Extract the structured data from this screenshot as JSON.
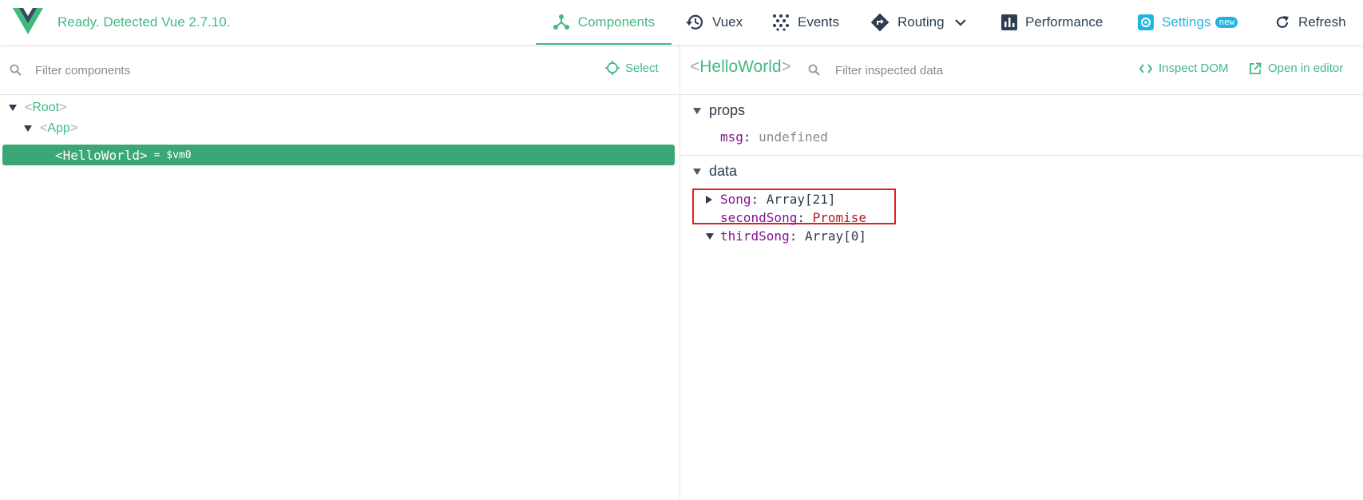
{
  "header": {
    "status": "Ready. Detected Vue 2.7.10.",
    "nav": {
      "components": "Components",
      "vuex": "Vuex",
      "events": "Events",
      "routing": "Routing",
      "performance": "Performance",
      "settings": "Settings",
      "settings_badge": "new",
      "refresh": "Refresh"
    },
    "active_tab": "Components"
  },
  "colors": {
    "accent": "#42b983",
    "selected_row": "#3ba776",
    "settings": "#1fb5e0",
    "highlight_box": "#e02020"
  },
  "component_tree": {
    "filter_placeholder": "Filter components",
    "select_label": "Select",
    "nodes": [
      {
        "name": "Root"
      },
      {
        "name": "App"
      },
      {
        "name": "HelloWorld",
        "vm_ref": "= $vm0",
        "selected": true
      }
    ]
  },
  "inspector": {
    "component_name": "HelloWorld",
    "filter_placeholder": "Filter inspected data",
    "inspect_dom": "Inspect DOM",
    "open_in_editor": "Open in editor",
    "props": {
      "title": "props",
      "items": [
        {
          "key": "msg",
          "value": "undefined"
        }
      ]
    },
    "data": {
      "title": "data",
      "items": [
        {
          "key": "Song",
          "value": "Array[21]"
        },
        {
          "key": "secondSong",
          "value": "Promise"
        },
        {
          "key": "thirdSong",
          "value": "Array[0]"
        }
      ]
    }
  }
}
